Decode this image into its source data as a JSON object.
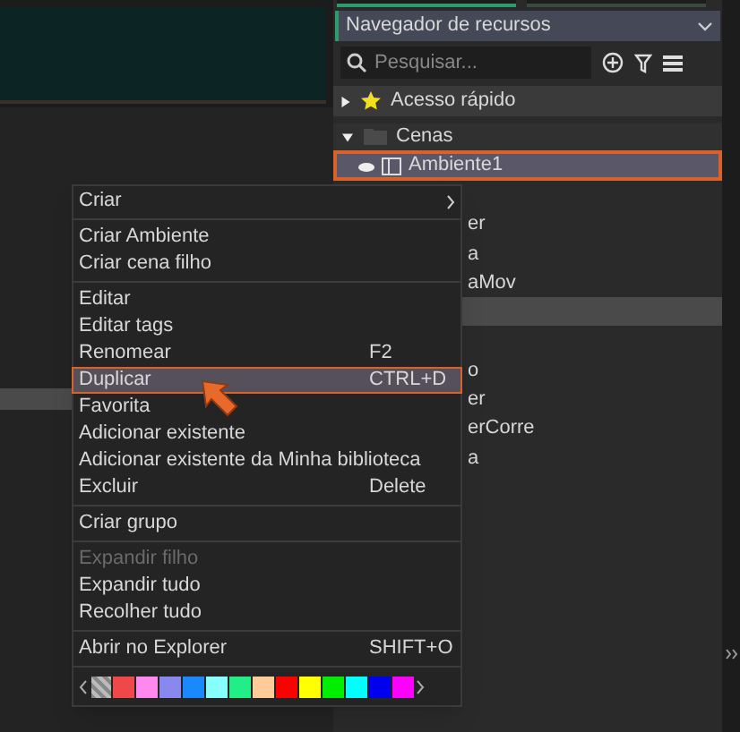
{
  "asset_browser": {
    "title": "Navegador de recursos",
    "search": {
      "placeholder": "Pesquisar..."
    },
    "quick_access": {
      "label": "Acesso rápido",
      "expanded": false
    },
    "folder": {
      "label": "Cenas",
      "expanded": true
    },
    "rows": [
      {
        "label": "Ambiente1",
        "selected": true
      },
      {
        "selected": false
      },
      {
        "label": "er",
        "selected": false
      },
      {
        "label": "a",
        "selected": false
      },
      {
        "label": "aMov",
        "selected": false
      },
      {
        "selected": true
      },
      {
        "selected": false
      },
      {
        "label": "o",
        "selected": false
      },
      {
        "label": "er",
        "selected": false
      },
      {
        "label": "erCorre",
        "selected": false
      },
      {
        "label": "a",
        "selected": false
      }
    ]
  },
  "context_menu": {
    "items": [
      {
        "kind": "submenu",
        "label": "Criar",
        "selected": false,
        "disabled": false
      },
      {
        "kind": "divider"
      },
      {
        "kind": "item",
        "label": "Criar Ambiente",
        "selected": false,
        "disabled": false
      },
      {
        "kind": "item",
        "label": "Criar cena filho",
        "selected": false,
        "disabled": false
      },
      {
        "kind": "divider"
      },
      {
        "kind": "item",
        "label": "Editar",
        "selected": false,
        "disabled": false
      },
      {
        "kind": "item",
        "label": "Editar tags",
        "selected": false,
        "disabled": false
      },
      {
        "kind": "item",
        "label": "Renomear",
        "shortcut": "F2",
        "selected": false,
        "disabled": false
      },
      {
        "kind": "item",
        "label": "Duplicar",
        "shortcut": "CTRL+D",
        "selected": true,
        "disabled": false
      },
      {
        "kind": "item",
        "label": "Favorita",
        "selected": false,
        "disabled": false
      },
      {
        "kind": "item",
        "label": "Adicionar existente",
        "selected": false,
        "disabled": false
      },
      {
        "kind": "item",
        "label": "Adicionar existente da Minha biblioteca",
        "selected": false,
        "disabled": false
      },
      {
        "kind": "item",
        "label": "Excluir",
        "shortcut": "Delete",
        "selected": false,
        "disabled": false
      },
      {
        "kind": "divider"
      },
      {
        "kind": "item",
        "label": "Criar grupo",
        "selected": false,
        "disabled": false
      },
      {
        "kind": "divider"
      },
      {
        "kind": "item",
        "label": "Expandir filho",
        "selected": false,
        "disabled": true
      },
      {
        "kind": "item",
        "label": "Expandir tudo",
        "selected": false,
        "disabled": false
      },
      {
        "kind": "item",
        "label": "Recolher tudo",
        "selected": false,
        "disabled": false
      },
      {
        "kind": "divider"
      },
      {
        "kind": "item",
        "label": "Abrir no Explorer",
        "shortcut": "SHIFT+O",
        "selected": false,
        "disabled": false
      },
      {
        "kind": "divider"
      },
      {
        "kind": "swatches",
        "swatches": [
          {
            "color": "#f04848"
          },
          {
            "color": "#ff88ee"
          },
          {
            "color": "#8888ee"
          },
          {
            "color": "#1a88ff"
          },
          {
            "color": "#88ffff"
          },
          {
            "color": "#22ee88"
          },
          {
            "color": "#ffcc99"
          },
          {
            "color": "#ff0000"
          },
          {
            "color": "#ffff00"
          },
          {
            "color": "#00ee00"
          },
          {
            "color": "#00ffff"
          },
          {
            "color": "#0000ee"
          },
          {
            "color": "#ff00ff"
          }
        ]
      }
    ]
  }
}
